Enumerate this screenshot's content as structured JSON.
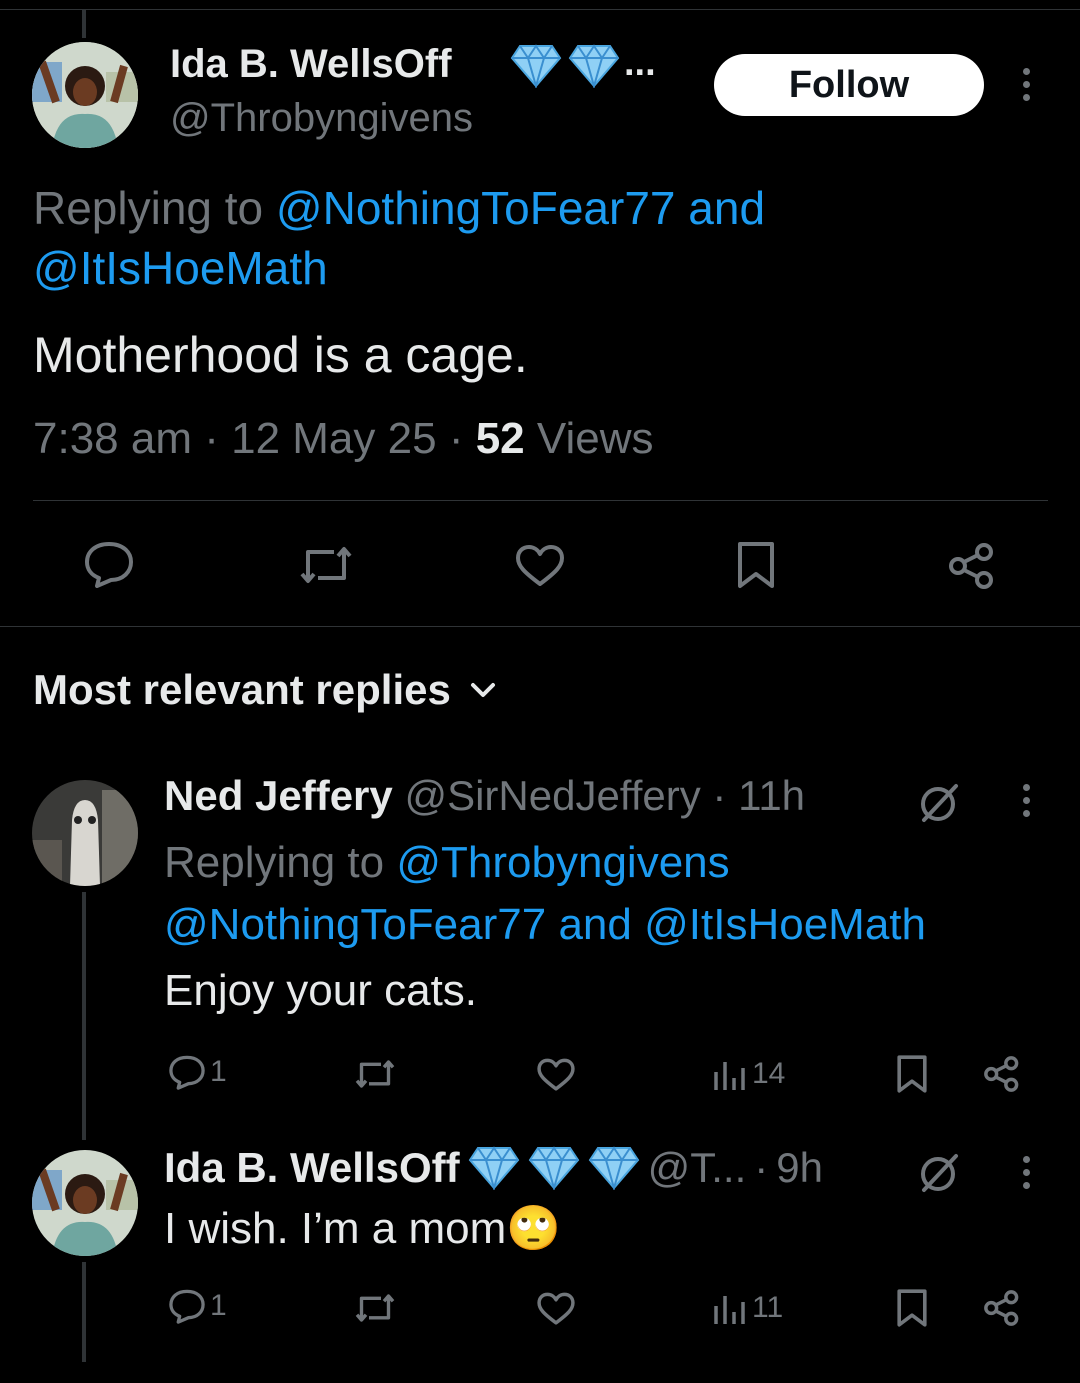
{
  "main_tweet": {
    "author_name": "Ida B. WellsOff",
    "more_indicator": "...",
    "handle": "@Throbyngivens",
    "follow_label": "Follow",
    "replying_prefix": "Replying to",
    "replying_handle_1": "@NothingToFear77",
    "replying_and": "and",
    "replying_handle_2": "@ItIsHoeMath",
    "text": "Motherhood is a cage.",
    "time": "7:38 am",
    "date": "12 May 25",
    "sep": "·",
    "views_count": "52",
    "views_label": "Views"
  },
  "replies_header": {
    "label": "Most relevant replies"
  },
  "replies": [
    {
      "author_name": "Ned Jeffery",
      "handle": "@SirNedJeffery",
      "sep": "·",
      "time": "11h",
      "replying_prefix": "Replying to",
      "replying_handle_1": "@Throbyngivens",
      "replying_handle_2": "@NothingToFear77",
      "replying_and": "and",
      "replying_handle_3": "@ItIsHoeMath",
      "text": "Enjoy your cats.",
      "reply_count": "1",
      "views": "14"
    },
    {
      "author_name": "Ida B. WellsOff",
      "handle": "@T...",
      "sep": "·",
      "time": "9h",
      "text": "I wish. I’m a mom",
      "emoji": "🙄",
      "reply_count": "1",
      "views": "11"
    }
  ],
  "colors": {
    "link": "#1d9bf0",
    "muted": "#71767b",
    "text": "#e7e9ea",
    "background": "#000000"
  },
  "icons": [
    "reply-icon",
    "repost-icon",
    "like-icon",
    "bookmark-icon",
    "share-icon",
    "views-icon",
    "grok-icon",
    "more-icon",
    "verified-diamond-icon",
    "chevron-down-icon"
  ]
}
